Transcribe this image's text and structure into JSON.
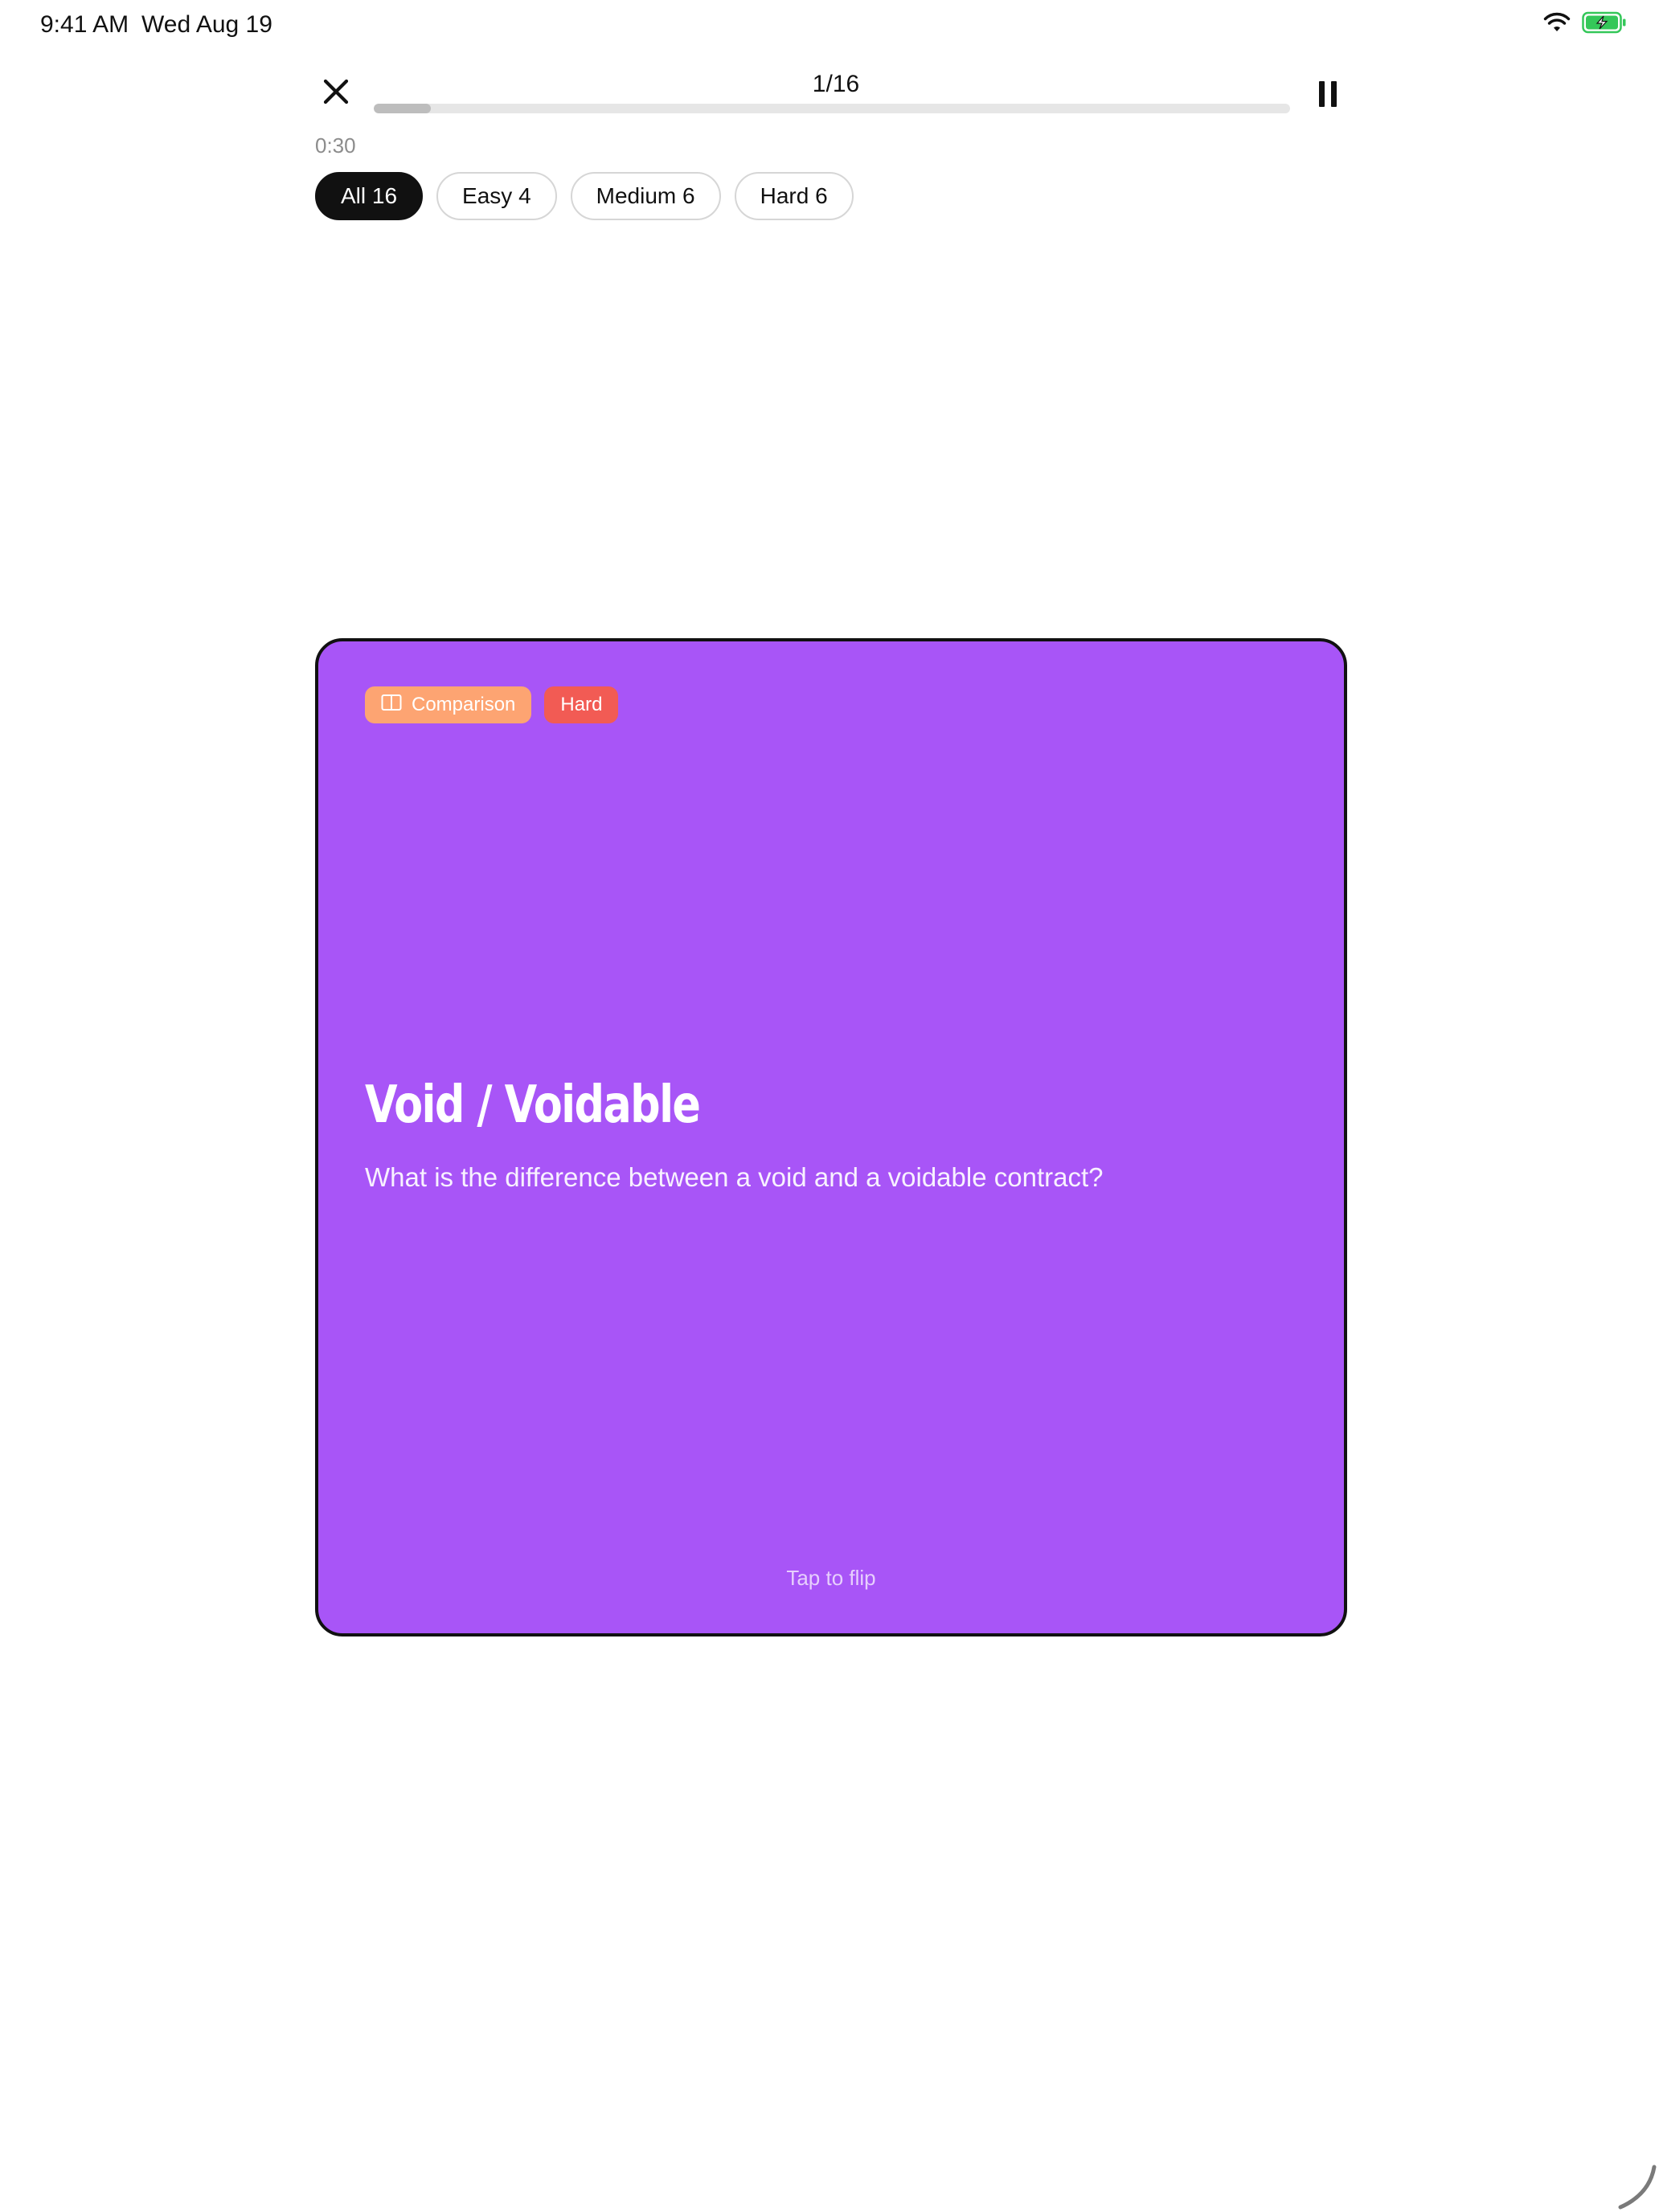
{
  "status_bar": {
    "time": "9:41 AM",
    "date": "Wed Aug 19",
    "battery_color": "#34c759"
  },
  "session": {
    "counter": "1/16",
    "progress_fraction": 0.0625,
    "timer": "0:30"
  },
  "filters": [
    {
      "label": "All 16",
      "active": true
    },
    {
      "label": "Easy 4",
      "active": false
    },
    {
      "label": "Medium 6",
      "active": false
    },
    {
      "label": "Hard 6",
      "active": false
    }
  ],
  "card": {
    "color": "#a855f7",
    "tags": {
      "type_label": "Comparison",
      "type_icon": "book-icon",
      "type_color": "#fda472",
      "difficulty_label": "Hard",
      "difficulty_color": "#f25b54"
    },
    "title": "Void / Voidable",
    "question": "What is the difference between a void and a voidable contract?",
    "hint": "Tap to flip"
  },
  "icons": {
    "close": "close-icon",
    "pause": "pause-icon",
    "wifi": "wifi-icon",
    "battery": "battery-charging-icon"
  }
}
